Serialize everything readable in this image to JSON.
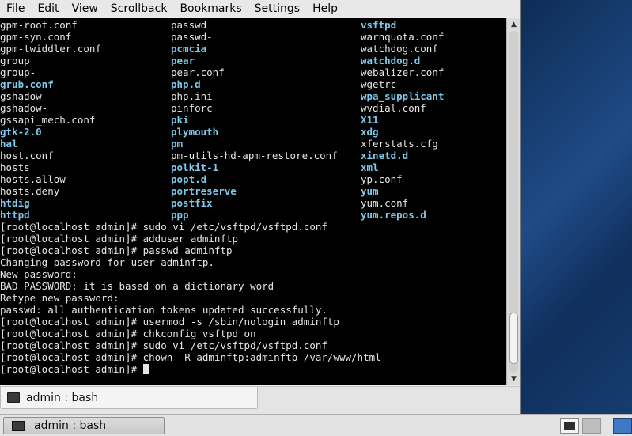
{
  "menubar": {
    "items": [
      "File",
      "Edit",
      "View",
      "Scrollback",
      "Bookmarks",
      "Settings",
      "Help"
    ]
  },
  "listing": {
    "rows": [
      [
        {
          "t": "gpm-root.conf",
          "d": false
        },
        {
          "t": "passwd",
          "d": false
        },
        {
          "t": "vsftpd",
          "d": true
        }
      ],
      [
        {
          "t": "gpm-syn.conf",
          "d": false
        },
        {
          "t": "passwd-",
          "d": false
        },
        {
          "t": "warnquota.conf",
          "d": false
        }
      ],
      [
        {
          "t": "gpm-twiddler.conf",
          "d": false
        },
        {
          "t": "pcmcia",
          "d": true
        },
        {
          "t": "watchdog.conf",
          "d": false
        }
      ],
      [
        {
          "t": "group",
          "d": false
        },
        {
          "t": "pear",
          "d": true
        },
        {
          "t": "watchdog.d",
          "d": true
        }
      ],
      [
        {
          "t": "group-",
          "d": false
        },
        {
          "t": "pear.conf",
          "d": false
        },
        {
          "t": "webalizer.conf",
          "d": false
        }
      ],
      [
        {
          "t": "grub.conf",
          "d": true
        },
        {
          "t": "php.d",
          "d": true
        },
        {
          "t": "wgetrc",
          "d": false
        }
      ],
      [
        {
          "t": "gshadow",
          "d": false
        },
        {
          "t": "php.ini",
          "d": false
        },
        {
          "t": "wpa_supplicant",
          "d": true
        }
      ],
      [
        {
          "t": "gshadow-",
          "d": false
        },
        {
          "t": "pinforc",
          "d": false
        },
        {
          "t": "wvdial.conf",
          "d": false
        }
      ],
      [
        {
          "t": "gssapi_mech.conf",
          "d": false
        },
        {
          "t": "pki",
          "d": true
        },
        {
          "t": "X11",
          "d": true
        }
      ],
      [
        {
          "t": "gtk-2.0",
          "d": true
        },
        {
          "t": "plymouth",
          "d": true
        },
        {
          "t": "xdg",
          "d": true
        }
      ],
      [
        {
          "t": "hal",
          "d": true
        },
        {
          "t": "pm",
          "d": true
        },
        {
          "t": "xferstats.cfg",
          "d": false
        }
      ],
      [
        {
          "t": "host.conf",
          "d": false
        },
        {
          "t": "pm-utils-hd-apm-restore.conf",
          "d": false
        },
        {
          "t": "xinetd.d",
          "d": true
        }
      ],
      [
        {
          "t": "hosts",
          "d": false
        },
        {
          "t": "polkit-1",
          "d": true
        },
        {
          "t": "xml",
          "d": true
        }
      ],
      [
        {
          "t": "hosts.allow",
          "d": false
        },
        {
          "t": "popt.d",
          "d": true
        },
        {
          "t": "yp.conf",
          "d": false
        }
      ],
      [
        {
          "t": "hosts.deny",
          "d": false
        },
        {
          "t": "portreserve",
          "d": true
        },
        {
          "t": "yum",
          "d": true
        }
      ],
      [
        {
          "t": "htdig",
          "d": true
        },
        {
          "t": "postfix",
          "d": true
        },
        {
          "t": "yum.conf",
          "d": false
        }
      ],
      [
        {
          "t": "httpd",
          "d": true
        },
        {
          "t": "ppp",
          "d": true
        },
        {
          "t": "yum.repos.d",
          "d": true
        }
      ]
    ]
  },
  "output_lines": [
    "[root@localhost admin]# sudo vi /etc/vsftpd/vsftpd.conf",
    "[root@localhost admin]# adduser adminftp",
    "[root@localhost admin]# passwd adminftp",
    "Changing password for user adminftp.",
    "New password:",
    "BAD PASSWORD: it is based on a dictionary word",
    "Retype new password:",
    "passwd: all authentication tokens updated successfully.",
    "[root@localhost admin]# usermod -s /sbin/nologin adminftp",
    "[root@localhost admin]# chkconfig vsftpd on",
    "[root@localhost admin]# sudo vi /etc/vsftpd/vsftpd.conf",
    "[root@localhost admin]# chown -R adminftp:adminftp /var/www/html"
  ],
  "prompt": "[root@localhost admin]# ",
  "scrollbar": {
    "position": 0.97,
    "visible_fraction": 0.15,
    "up_icon": "arrow-up-icon",
    "down_icon": "arrow-down-icon"
  },
  "tab": {
    "label": "admin : bash",
    "icon": "terminal-icon"
  },
  "taskbar": {
    "task_label": "admin : bash",
    "task_icon": "terminal-icon"
  },
  "colors": {
    "directory": "#7ec8ec",
    "text": "#e6e6e6",
    "background": "#000000"
  }
}
